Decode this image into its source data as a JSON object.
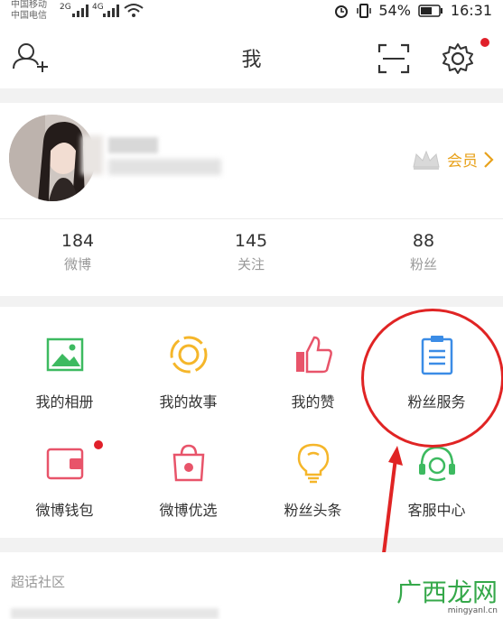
{
  "status_bar": {
    "carrier_1": "中国移动",
    "carrier_2": "中国电信",
    "net_1": "2G",
    "net_2": "4G",
    "battery": "54%",
    "time": "16:31"
  },
  "header": {
    "title": "我"
  },
  "profile": {
    "vip_label": "会员",
    "stats": [
      {
        "value": "184",
        "label": "微博"
      },
      {
        "value": "145",
        "label": "关注"
      },
      {
        "value": "88",
        "label": "粉丝"
      }
    ]
  },
  "services": [
    {
      "label": "我的相册",
      "icon": "album-icon",
      "color": "#3dba60"
    },
    {
      "label": "我的故事",
      "icon": "story-icon",
      "color": "#f5b62a"
    },
    {
      "label": "我的赞",
      "icon": "thumbs-up-icon",
      "color": "#e8546a"
    },
    {
      "label": "粉丝服务",
      "icon": "clipboard-icon",
      "color": "#3b8ce6"
    },
    {
      "label": "微博钱包",
      "icon": "wallet-icon",
      "color": "#e8546a"
    },
    {
      "label": "微博优选",
      "icon": "shopping-bag-icon",
      "color": "#e8546a"
    },
    {
      "label": "粉丝头条",
      "icon": "lightbulb-icon",
      "color": "#f5b62a"
    },
    {
      "label": "客服中心",
      "icon": "headset-icon",
      "color": "#3dba60"
    }
  ],
  "supertopic": {
    "title": "超话社区"
  },
  "watermark": {
    "cn": "广西龙网",
    "en": "mingyanl.cn"
  }
}
